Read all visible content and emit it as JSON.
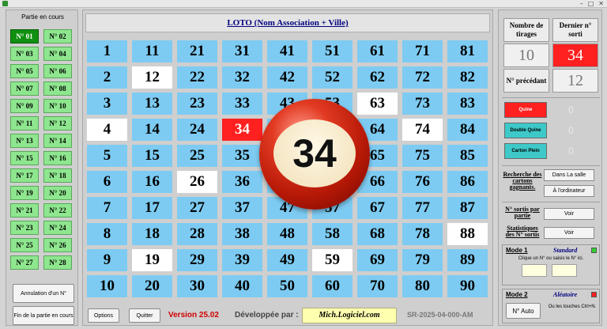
{
  "window": {
    "minimize": "–",
    "maximize": "□",
    "close": "✕"
  },
  "left": {
    "title": "Partie en cours",
    "games": [
      "N° 01",
      "N° 02",
      "N° 03",
      "N° 04",
      "N° 05",
      "N° 06",
      "N° 07",
      "N° 08",
      "N° 09",
      "N° 10",
      "N° 11",
      "N° 12",
      "N° 13",
      "N° 14",
      "N° 15",
      "N° 16",
      "N° 17",
      "N° 18",
      "N° 19",
      "N° 20",
      "N° 21",
      "N° 22",
      "N° 23",
      "N° 24",
      "N° 25",
      "N° 26",
      "N° 27",
      "N° 28"
    ],
    "active_game": 0,
    "cancel_label": "Annulation d'un N°",
    "end_label": "Fin de la partie en cours"
  },
  "center": {
    "title": "LOTO (Nom Association + Ville)",
    "drawn_numbers": [
      4,
      12,
      19,
      26,
      34,
      59,
      63,
      74,
      88
    ],
    "last_drawn": 34,
    "ball_number": "34"
  },
  "bottom": {
    "options_label": "Options",
    "quit_label": "Quitter",
    "version": "Version 25.02",
    "developed_by": "Développée par :",
    "website": "Mich.Logiciel.com",
    "serial": "SR-2025-04-000-AM"
  },
  "right": {
    "nb_tirages_label": "Nombre de tirages",
    "dernier_label": "Dernier n° sorti",
    "nb_tirages_value": "10",
    "dernier_value": "34",
    "precedant_label": "N° précédant",
    "precedant_value": "12",
    "quine_label": "Quine",
    "quine_value": "0",
    "double_quine_label": "Double Quine",
    "double_quine_value": "0",
    "carton_plein_label": "Carton Plein",
    "carton_plein_value": "0",
    "search_text": "Recherche des cartons gagnants.",
    "search_hall_label": "Dans La salle",
    "search_pc_label": "À l'ordinateur",
    "sortis_text": "N° sortis par partie",
    "sortis_btn": "Voir",
    "stats_text": "Statistiques des N° sortis",
    "stats_btn": "Voir",
    "mode1_title": "Mode 1",
    "mode1_name": "Standard",
    "mode1_hint": "Clique un N° ou saisis le N° ici.",
    "mode2_title": "Mode 2",
    "mode2_name": "Aléatoire",
    "mode2_btn": "N° Auto",
    "mode2_hint": "Ou les touches Ctrl+N.",
    "colors": {
      "quine": "#ff2020",
      "teal": "#3ec8c8",
      "mode1_dot": "#30d030",
      "mode2_dot": "#ff2020"
    }
  }
}
